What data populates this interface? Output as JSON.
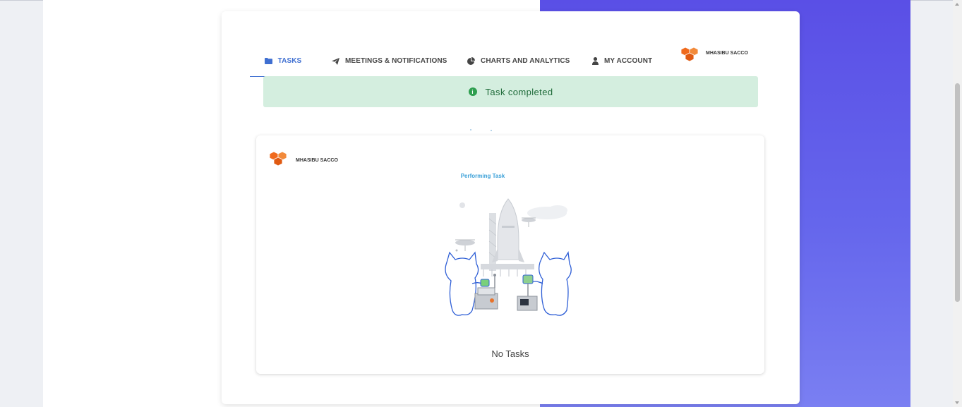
{
  "tabs": [
    {
      "label": "TASKS",
      "icon": "folder-icon",
      "active": true
    },
    {
      "label": "MEETINGS & NOTIFICATIONS",
      "icon": "paper-plane-icon",
      "active": false
    },
    {
      "label": "CHARTS AND ANALYTICS",
      "icon": "pie-chart-icon",
      "active": false
    },
    {
      "label": "MY ACCOUNT",
      "icon": "user-icon",
      "active": false
    }
  ],
  "brand": {
    "name": "MHASIBU SACCO",
    "logo": "boxes-logo-icon",
    "color": "#f06a1d"
  },
  "alert": {
    "message": "Task completed",
    "icon": "info-icon",
    "background": "#d4eedf",
    "text_color": "#1f6b3a"
  },
  "panel": {
    "brand_name": "MHASIBU SACCO",
    "status": "Performing Task",
    "illustration": "octocats-rocket-launch-illustration",
    "empty_message": "No Tasks"
  },
  "colors": {
    "accent": "#3f6fd1",
    "gradient_top": "#5a4fe6",
    "gradient_bottom": "#7a7ff2"
  }
}
